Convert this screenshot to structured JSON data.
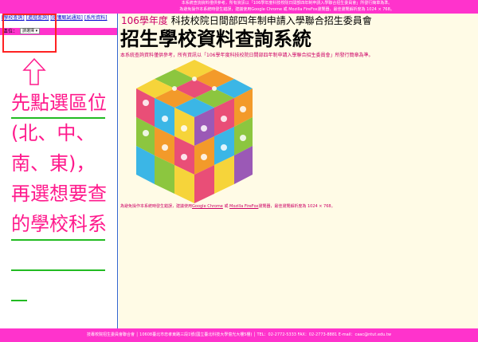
{
  "top_banner": {
    "line1": "本系統查詢資料僅供參考，所有資訊以「106學年度科技校院日間部四年制申請入學聯合招生委員會」所發行簡章為準。",
    "line2": "為避免操作本系統時發生錯誤，建議使用Google Chrome 或 Mozilla FireFox瀏覽器，最佳瀏覽解析度為 1024 × 768。"
  },
  "sidebar": {
    "links": [
      "[學校查詢]",
      "[進階查詢]",
      "[接獲甄試通知]",
      "[系所資料]",
      "[簡章]"
    ],
    "region_label": "區位：",
    "region_select": "請選擇 ▾",
    "annotation_text": "先點選區位(北、中、南、東)，再選想要查的學校科系"
  },
  "main": {
    "year_prefix": "106學年度",
    "year_rest": " 科技校院日間部四年制申請入學聯合招生委員會",
    "big_title": "招生學校資料查詢系統",
    "subtitle": "本系統查詢資料僅供參考，所有資訊以「106學年度科技校院日間部四年制申請入學聯合招生委員會」所發行簡章為準。",
    "note_prefix": "為避免操作本系統時發生錯誤，建議使用",
    "note_chrome": "Google Chrome",
    "note_or": " 或 ",
    "note_firefox": "Mozilla FireFox",
    "note_suffix": "瀏覽器，最佳瀏覽解析度為 1024 × 768。"
  },
  "footer": {
    "text": "技專校院招生委員會聯合會 │ 10608臺北市忠孝東路三段1號(國立臺北科技大學億光大樓5樓) │ TEL：02-2772-5333 FAX：02-2773-8881 E-mail：caac@ntut.edu.tw"
  },
  "colors": {
    "banner": "#ff33cc",
    "accent_text": "#cc0066",
    "annotation": "#ff1a8c",
    "highlight_box": "#ff2222",
    "underline": "#22bb22"
  }
}
